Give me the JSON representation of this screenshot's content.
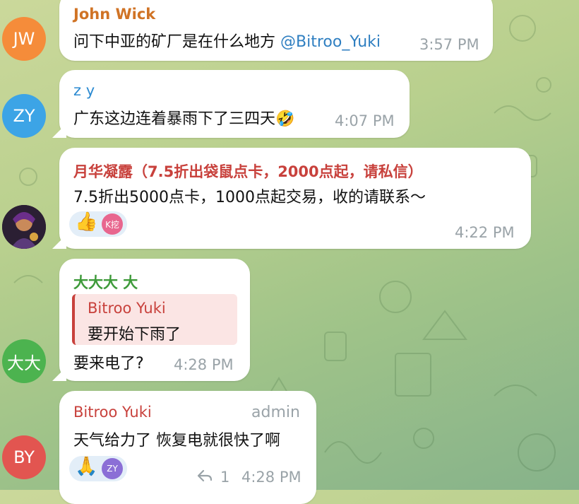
{
  "colors": {
    "jw": "#f58c3a",
    "zy": "#3ca4e6",
    "dada": "#4cb34f",
    "by": "#e25550",
    "sender_orange": "#d07325",
    "sender_blue": "#2b8ad1",
    "sender_red": "#c8413c",
    "sender_green": "#3e9a3a",
    "time": "#9aa3a8",
    "mention": "#2f7fc1"
  },
  "messages": [
    {
      "avatar_initials": "JW",
      "sender": "John Wick",
      "text": "问下中亚的矿厂是在什么地方 ",
      "mention": "@Bitroo_Yuki",
      "time": "3:57 PM"
    },
    {
      "avatar_initials": "ZY",
      "sender": "z y",
      "text": "广东这边连着暴雨下了三四天",
      "emoji": "🤣",
      "time": "4:07 PM"
    },
    {
      "avatar_icon": "profile-photo",
      "sender": "月华凝露（7.5折出袋鼠点卡，2000点起，请私信）",
      "text": "7.5折出5000点卡，1000点起交易，收的请联系～",
      "reaction_emoji": "👍",
      "reaction_user": "K挖",
      "time": "4:22 PM"
    },
    {
      "avatar_initials": "大大",
      "sender": "大大大 大",
      "reply_to_sender": "Bitroo Yuki",
      "reply_to_text": "要开始下雨了",
      "text": "要来电了?",
      "time": "4:28 PM"
    },
    {
      "avatar_initials": "BY",
      "sender": "Bitroo Yuki",
      "role": "admin",
      "text": "天气给力了 恢复电就很快了啊",
      "reaction_emoji": "🙏",
      "reaction_user": "ZY",
      "reply_count": "1",
      "time": "4:28 PM"
    }
  ]
}
